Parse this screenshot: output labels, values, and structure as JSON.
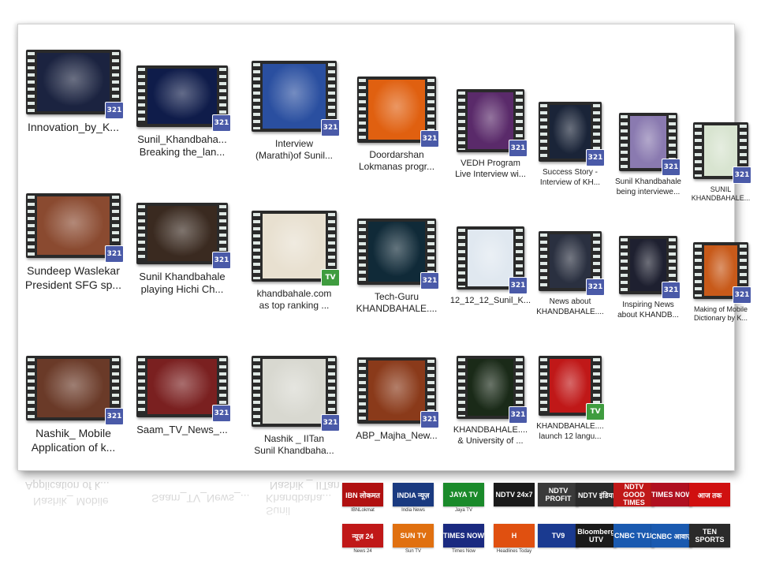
{
  "videos": [
    {
      "label": "Innovation_by_K...",
      "badge": "321",
      "bg": "#1b2340",
      "fs": 14
    },
    {
      "label": "Sunil_Khandbaha...\nBreaking the_lan...",
      "badge": "321",
      "bg": "#0f1c4a",
      "fs": 13
    },
    {
      "label": "Interview\n(Marathi)of Sunil...",
      "badge": "321",
      "bg": "#2a4fa0",
      "fs": 12
    },
    {
      "label": "Doordarshan\nLokmanas progr...",
      "badge": "321",
      "bg": "#e06010",
      "fs": 12
    },
    {
      "label": "VEDH Program\nLive Interview wi...",
      "badge": "321",
      "bg": "#5a2a6a",
      "fs": 11
    },
    {
      "label": "Success Story -\nInterview of KH...",
      "badge": "321",
      "bg": "#1a2438",
      "fs": 10
    },
    {
      "label": "Sunil Khandbahale\nbeing interviewe...",
      "badge": "321",
      "bg": "#8a7ab0",
      "fs": 10
    },
    {
      "label": "SUNIL\nKHANDBAHALE...",
      "badge": "321",
      "bg": "#d8e4d0",
      "fs": 9
    },
    {
      "label": "Sundeep Waslekar\nPresident SFG sp...",
      "badge": "321",
      "bg": "#8a4a30",
      "fs": 14
    },
    {
      "label": "Sunil Khandbahale\nplaying Hichi Ch...",
      "badge": "321",
      "bg": "#3a2a20",
      "fs": 13
    },
    {
      "label": "khandbahale.com\nas top ranking ...",
      "badge": "TV",
      "bg": "#e8e0d0",
      "fs": 12
    },
    {
      "label": "Tech-Guru\nKHANDBAHALE....",
      "badge": "321",
      "bg": "#102a38",
      "fs": 12
    },
    {
      "label": "12_12_12_Sunil_K...",
      "badge": "321",
      "bg": "#e0e8f0",
      "fs": 11
    },
    {
      "label": "News about\nKHANDBAHALE....",
      "badge": "321",
      "bg": "#2a3040",
      "fs": 10
    },
    {
      "label": "Inspiring News\nabout KHANDB...",
      "badge": "321",
      "bg": "#1e2030",
      "fs": 10
    },
    {
      "label": "Making of Mobile\nDictionary by K...",
      "badge": "321",
      "bg": "#c85a1a",
      "fs": 9
    },
    {
      "label": "Nashik_ Mobile\nApplication of k...",
      "badge": "321",
      "bg": "#6a3a28",
      "fs": 14
    },
    {
      "label": "Saam_TV_News_...",
      "badge": "321",
      "bg": "#7a2020",
      "fs": 13
    },
    {
      "label": "Nashik _ IITan\nSunil Khandbaha...",
      "badge": "321",
      "bg": "#d8d8d0",
      "fs": 12
    },
    {
      "label": "ABP_Majha_New...",
      "badge": "321",
      "bg": "#8a3a1a",
      "fs": 12
    },
    {
      "label": "KHANDBAHALE....\n& University of ...",
      "badge": "321",
      "bg": "#1a2a18",
      "fs": 11
    },
    {
      "label": "KHANDBAHALE....\nlaunch 12 langu...",
      "badge": "TV",
      "bg": "#c01818",
      "fs": 10
    }
  ],
  "reflection": [
    "Application of k...",
    "Nashik_ Mobile",
    "Saam_TV_News_...",
    "Nashik _ IITan",
    "Sunil Khandbaha..."
  ],
  "logos": [
    {
      "name": "IBN लोकमत",
      "caption": "IBNLokmat",
      "color": "#b01010"
    },
    {
      "name": "INDIA न्यूज़",
      "caption": "India News",
      "color": "#1a3a80"
    },
    {
      "name": "JAYA TV",
      "caption": "Jaya TV",
      "color": "#1a8a2a"
    },
    {
      "name": "NDTV 24x7",
      "caption": "",
      "color": "#1a1a1a"
    },
    {
      "name": "NDTV PROFIT",
      "caption": "",
      "color": "#3a3a3a"
    },
    {
      "name": "NDTV इंडिया",
      "caption": "",
      "color": "#2a2a2a"
    },
    {
      "name": "NDTV GOOD TIMES",
      "caption": "",
      "color": "#c01818"
    },
    {
      "name": "TIMES NOW",
      "caption": "",
      "color": "#b01020"
    },
    {
      "name": "आज तक",
      "caption": "",
      "color": "#d01010"
    },
    {
      "name": "न्यूज़ 24",
      "caption": "News 24",
      "color": "#c01818"
    },
    {
      "name": "SUN TV",
      "caption": "Sun TV",
      "color": "#e07010"
    },
    {
      "name": "TIMES NOW",
      "caption": "Times Now",
      "color": "#1a2a80"
    },
    {
      "name": "H",
      "caption": "Headlines Today",
      "color": "#e05010"
    },
    {
      "name": "TV9",
      "caption": "",
      "color": "#1a3a90"
    },
    {
      "name": "Bloomberg UTV",
      "caption": "",
      "color": "#1a1a1a"
    },
    {
      "name": "CNBC TV18",
      "caption": "",
      "color": "#1a5ab0"
    },
    {
      "name": "CNBC आवाज़",
      "caption": "",
      "color": "#1a5ab0"
    },
    {
      "name": "TEN SPORTS",
      "caption": "",
      "color": "#2a2a2a"
    }
  ]
}
